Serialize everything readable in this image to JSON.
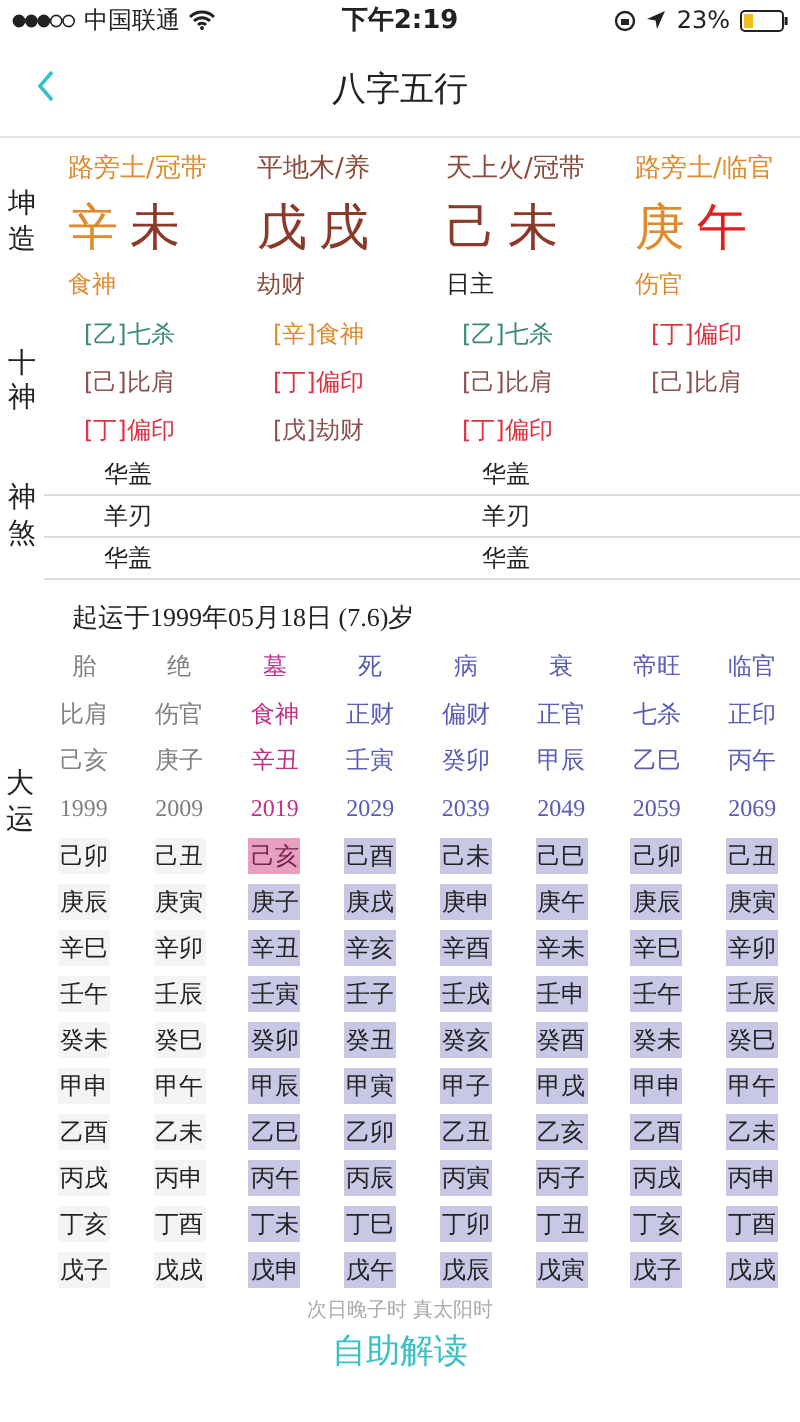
{
  "status_bar": {
    "carrier": "中国联通",
    "time": "下午2:19",
    "battery": "23%"
  },
  "nav": {
    "title": "八字五行"
  },
  "pillars": {
    "label": "坤造",
    "columns": [
      {
        "nayin": {
          "text": "路旁土/冠带",
          "color": "#e08a2c"
        },
        "stem": {
          "text": "辛",
          "color": "#e08a2c"
        },
        "branch": {
          "text": "未",
          "color": "#8b3a2a"
        },
        "god": {
          "text": "食神",
          "color": "#e08a2c"
        }
      },
      {
        "nayin": {
          "text": "平地木/养",
          "color": "#8b4a3a"
        },
        "stem": {
          "text": "戊",
          "color": "#8b3a2a"
        },
        "branch": {
          "text": "戌",
          "color": "#8b3a2a"
        },
        "god": {
          "text": "劫财",
          "color": "#8b4a3a"
        }
      },
      {
        "nayin": {
          "text": "天上火/冠带",
          "color": "#8b4a3a"
        },
        "stem": {
          "text": "己",
          "color": "#8b3a2a"
        },
        "branch": {
          "text": "未",
          "color": "#8b3a2a"
        },
        "god": {
          "text": "日主",
          "color": "#222222"
        }
      },
      {
        "nayin": {
          "text": "路旁土/临官",
          "color": "#e08a2c"
        },
        "stem": {
          "text": "庚",
          "color": "#e08a2c"
        },
        "branch": {
          "text": "午",
          "color": "#e02020"
        },
        "god": {
          "text": "伤官",
          "color": "#e08a2c"
        }
      }
    ]
  },
  "ten_gods": {
    "label": "十神",
    "columns": [
      [
        {
          "text": "[乙]七杀",
          "color": "#3a8a7a"
        },
        {
          "text": "[己]比肩",
          "color": "#8b5050"
        },
        {
          "text": "[丁]偏印",
          "color": "#e03040"
        }
      ],
      [
        {
          "text": "[辛]食神",
          "color": "#e08a2c"
        },
        {
          "text": "[丁]偏印",
          "color": "#e03040"
        },
        {
          "text": "[戊]劫财",
          "color": "#8b5050"
        }
      ],
      [
        {
          "text": "[乙]七杀",
          "color": "#3a8a7a"
        },
        {
          "text": "[己]比肩",
          "color": "#8b5050"
        },
        {
          "text": "[丁]偏印",
          "color": "#e03040"
        }
      ],
      [
        {
          "text": "[丁]偏印",
          "color": "#e03040"
        },
        {
          "text": "[己]比肩",
          "color": "#8b5050"
        }
      ]
    ]
  },
  "shensha": {
    "label": "神煞",
    "rows": [
      [
        "华盖",
        "",
        "华盖",
        ""
      ],
      [
        "羊刃",
        "",
        "羊刃",
        ""
      ],
      [
        "华盖",
        "",
        "华盖",
        ""
      ]
    ]
  },
  "dayun": {
    "label": "大运",
    "start_text": "起运于1999年05月18日 (7.6)岁",
    "columns": [
      {
        "kind": "past",
        "phase": "胎",
        "god": "比肩",
        "ganzhi": "己亥",
        "year": "1999",
        "years": [
          {
            "text": "己卯",
            "selected": false
          },
          {
            "text": "庚辰",
            "selected": false
          },
          {
            "text": "辛巳",
            "selected": false
          },
          {
            "text": "壬午",
            "selected": false
          },
          {
            "text": "癸未",
            "selected": false
          },
          {
            "text": "甲申",
            "selected": false
          },
          {
            "text": "乙酉",
            "selected": false
          },
          {
            "text": "丙戌",
            "selected": false
          },
          {
            "text": "丁亥",
            "selected": false
          },
          {
            "text": "戊子",
            "selected": false
          }
        ]
      },
      {
        "kind": "past",
        "phase": "绝",
        "god": "伤官",
        "ganzhi": "庚子",
        "year": "2009",
        "years": [
          {
            "text": "己丑",
            "selected": false
          },
          {
            "text": "庚寅",
            "selected": false
          },
          {
            "text": "辛卯",
            "selected": false
          },
          {
            "text": "壬辰",
            "selected": false
          },
          {
            "text": "癸巳",
            "selected": false
          },
          {
            "text": "甲午",
            "selected": false
          },
          {
            "text": "乙未",
            "selected": false
          },
          {
            "text": "丙申",
            "selected": false
          },
          {
            "text": "丁酉",
            "selected": false
          },
          {
            "text": "戊戌",
            "selected": false
          }
        ]
      },
      {
        "kind": "current",
        "phase": "墓",
        "god": "食神",
        "ganzhi": "辛丑",
        "year": "2019",
        "years": [
          {
            "text": "己亥",
            "selected": true
          },
          {
            "text": "庚子",
            "selected": false
          },
          {
            "text": "辛丑",
            "selected": false
          },
          {
            "text": "壬寅",
            "selected": false
          },
          {
            "text": "癸卯",
            "selected": false
          },
          {
            "text": "甲辰",
            "selected": false
          },
          {
            "text": "乙巳",
            "selected": false
          },
          {
            "text": "丙午",
            "selected": false
          },
          {
            "text": "丁未",
            "selected": false
          },
          {
            "text": "戊申",
            "selected": false
          }
        ]
      },
      {
        "kind": "future",
        "phase": "死",
        "god": "正财",
        "ganzhi": "壬寅",
        "year": "2029",
        "years": [
          {
            "text": "己酉",
            "selected": false
          },
          {
            "text": "庚戌",
            "selected": false
          },
          {
            "text": "辛亥",
            "selected": false
          },
          {
            "text": "壬子",
            "selected": false
          },
          {
            "text": "癸丑",
            "selected": false
          },
          {
            "text": "甲寅",
            "selected": false
          },
          {
            "text": "乙卯",
            "selected": false
          },
          {
            "text": "丙辰",
            "selected": false
          },
          {
            "text": "丁巳",
            "selected": false
          },
          {
            "text": "戊午",
            "selected": false
          }
        ]
      },
      {
        "kind": "future",
        "phase": "病",
        "god": "偏财",
        "ganzhi": "癸卯",
        "year": "2039",
        "years": [
          {
            "text": "己未",
            "selected": false
          },
          {
            "text": "庚申",
            "selected": false
          },
          {
            "text": "辛酉",
            "selected": false
          },
          {
            "text": "壬戌",
            "selected": false
          },
          {
            "text": "癸亥",
            "selected": false
          },
          {
            "text": "甲子",
            "selected": false
          },
          {
            "text": "乙丑",
            "selected": false
          },
          {
            "text": "丙寅",
            "selected": false
          },
          {
            "text": "丁卯",
            "selected": false
          },
          {
            "text": "戊辰",
            "selected": false
          }
        ]
      },
      {
        "kind": "future",
        "phase": "衰",
        "god": "正官",
        "ganzhi": "甲辰",
        "year": "2049",
        "years": [
          {
            "text": "己巳",
            "selected": false
          },
          {
            "text": "庚午",
            "selected": false
          },
          {
            "text": "辛未",
            "selected": false
          },
          {
            "text": "壬申",
            "selected": false
          },
          {
            "text": "癸酉",
            "selected": false
          },
          {
            "text": "甲戌",
            "selected": false
          },
          {
            "text": "乙亥",
            "selected": false
          },
          {
            "text": "丙子",
            "selected": false
          },
          {
            "text": "丁丑",
            "selected": false
          },
          {
            "text": "戊寅",
            "selected": false
          }
        ]
      },
      {
        "kind": "future",
        "phase": "帝旺",
        "god": "七杀",
        "ganzhi": "乙巳",
        "year": "2059",
        "years": [
          {
            "text": "己卯",
            "selected": false
          },
          {
            "text": "庚辰",
            "selected": false
          },
          {
            "text": "辛巳",
            "selected": false
          },
          {
            "text": "壬午",
            "selected": false
          },
          {
            "text": "癸未",
            "selected": false
          },
          {
            "text": "甲申",
            "selected": false
          },
          {
            "text": "乙酉",
            "selected": false
          },
          {
            "text": "丙戌",
            "selected": false
          },
          {
            "text": "丁亥",
            "selected": false
          },
          {
            "text": "戊子",
            "selected": false
          }
        ]
      },
      {
        "kind": "future",
        "phase": "临官",
        "god": "正印",
        "ganzhi": "丙午",
        "year": "2069",
        "years": [
          {
            "text": "己丑",
            "selected": false
          },
          {
            "text": "庚寅",
            "selected": false
          },
          {
            "text": "辛卯",
            "selected": false
          },
          {
            "text": "壬辰",
            "selected": false
          },
          {
            "text": "癸巳",
            "selected": false
          },
          {
            "text": "甲午",
            "selected": false
          },
          {
            "text": "乙未",
            "selected": false
          },
          {
            "text": "丙申",
            "selected": false
          },
          {
            "text": "丁酉",
            "selected": false
          },
          {
            "text": "戊戌",
            "selected": false
          }
        ]
      }
    ]
  },
  "footer": {
    "note": "次日晚子时 真太阳时",
    "button": "自助解读"
  }
}
